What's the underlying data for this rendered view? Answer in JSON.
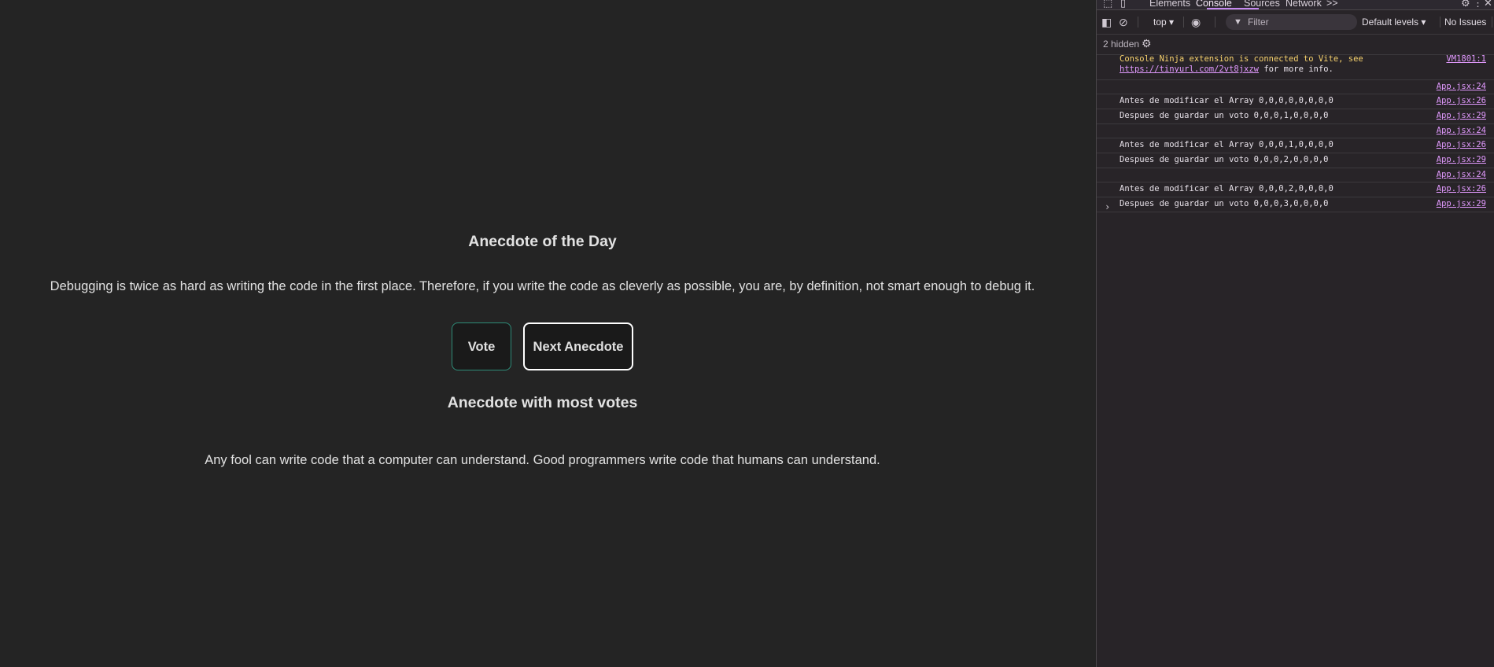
{
  "app": {
    "title": "Anecdote of the Day",
    "anecdote": "Debugging is twice as hard as writing the code in the first place. Therefore, if you write the code as cleverly as possible, you are, by definition, not smart enough to debug it.",
    "vote_label": "Vote",
    "next_label": "Next Anecdote",
    "most_votes_title": "Anecdote with most votes",
    "most_votes_text": "Any fool can write code that a computer can understand. Good programmers write code that humans can understand."
  },
  "devtools": {
    "tabs": [
      "Elements",
      "Console",
      "Sources",
      "Network"
    ],
    "more_tabs": ">>",
    "context": "top",
    "filter_placeholder": "Filter",
    "levels": "Default levels",
    "issues": "No Issues",
    "hidden": "2 hidden",
    "messages": [
      {
        "text": "Console Ninja extension is connected to Vite, see",
        "link": "https://tinyurl.com/2vt8jxzw",
        "after": " for more info.",
        "source": "VM1801:1",
        "type": "warn"
      },
      {
        "text": "",
        "source": "App.jsx:24"
      },
      {
        "text": "Antes de modificar el Array 0,0,0,0,0,0,0,0",
        "source": "App.jsx:26"
      },
      {
        "text": "Despues de guardar un voto 0,0,0,1,0,0,0,0",
        "source": "App.jsx:29"
      },
      {
        "text": "",
        "source": "App.jsx:24"
      },
      {
        "text": "Antes de modificar el Array 0,0,0,1,0,0,0,0",
        "source": "App.jsx:26"
      },
      {
        "text": "Despues de guardar un voto 0,0,0,2,0,0,0,0",
        "source": "App.jsx:29"
      },
      {
        "text": "",
        "source": "App.jsx:24"
      },
      {
        "text": "Antes de modificar el Array 0,0,0,2,0,0,0,0",
        "source": "App.jsx:26"
      },
      {
        "text": "Despues de guardar un voto 0,0,0,3,0,0,0,0",
        "source": "App.jsx:29"
      }
    ],
    "prompt": "›"
  }
}
